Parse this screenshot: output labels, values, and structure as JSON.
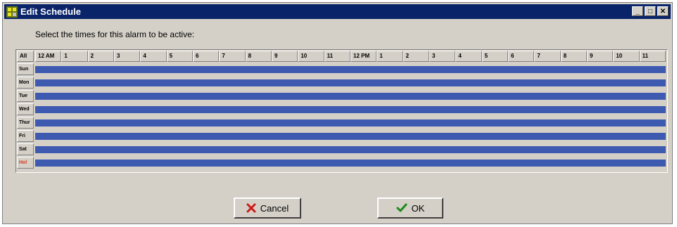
{
  "window": {
    "title": "Edit Schedule",
    "controls": {
      "minimize": "_",
      "maximize": "□",
      "close": "✕"
    }
  },
  "instruction": "Select the times for this alarm to be active:",
  "schedule": {
    "corner_label": "All",
    "hours": [
      "12 AM",
      "1",
      "2",
      "3",
      "4",
      "5",
      "6",
      "7",
      "8",
      "9",
      "10",
      "11",
      "12 PM",
      "1",
      "2",
      "3",
      "4",
      "5",
      "6",
      "7",
      "8",
      "9",
      "10",
      "11"
    ],
    "days": [
      "Sun",
      "Mon",
      "Tue",
      "Wed",
      "Thur",
      "Fri",
      "Sat",
      "Hol"
    ],
    "bar_color": "#3d5ab0",
    "holiday_label_color": "#d04020"
  },
  "buttons": {
    "cancel": "Cancel",
    "ok": "OK"
  },
  "icons": {
    "app": "schedule-app-icon",
    "cancel": "red-x-icon",
    "ok": "green-check-icon"
  }
}
